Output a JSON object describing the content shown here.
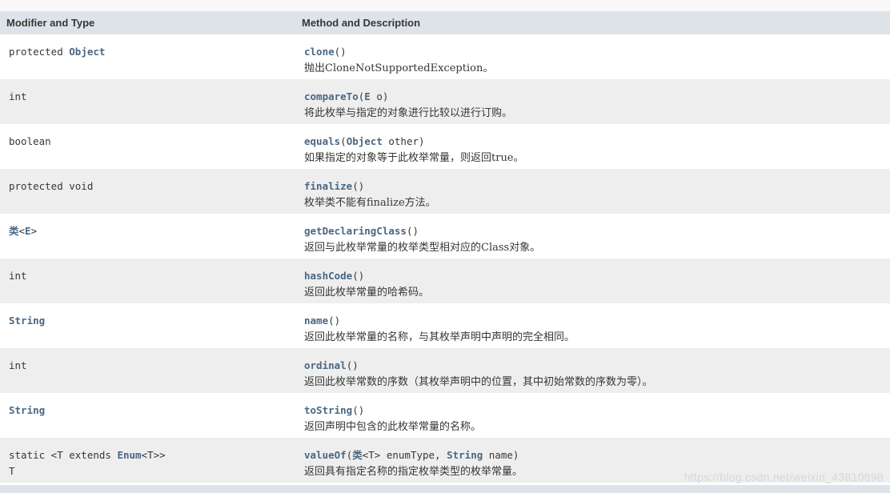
{
  "header": {
    "col1": "Modifier and Type",
    "col2": "Method and Description"
  },
  "rows": [
    {
      "type_parts": [
        {
          "t": "protected ",
          "link": false
        },
        {
          "t": "Object",
          "link": true
        }
      ],
      "method": "clone",
      "params": [
        {
          "t": "()",
          "link": false
        }
      ],
      "desc": "抛出CloneNotSupportedException。"
    },
    {
      "type_parts": [
        {
          "t": "int",
          "link": false
        }
      ],
      "method": "compareTo",
      "params": [
        {
          "t": "(",
          "link": false
        },
        {
          "t": "E",
          "link": true
        },
        {
          "t": " o)",
          "link": false
        }
      ],
      "desc": "将此枚举与指定的对象进行比较以进行订购。"
    },
    {
      "type_parts": [
        {
          "t": "boolean",
          "link": false
        }
      ],
      "method": "equals",
      "params": [
        {
          "t": "(",
          "link": false
        },
        {
          "t": "Object",
          "link": true
        },
        {
          "t": " other)",
          "link": false
        }
      ],
      "desc": "如果指定的对象等于此枚举常量，则返回true。"
    },
    {
      "type_parts": [
        {
          "t": "protected void",
          "link": false
        }
      ],
      "method": "finalize",
      "params": [
        {
          "t": "()",
          "link": false
        }
      ],
      "desc": "枚举类不能有finalize方法。"
    },
    {
      "type_parts": [
        {
          "t": "类",
          "link": true
        },
        {
          "t": "<",
          "link": false
        },
        {
          "t": "E",
          "link": true
        },
        {
          "t": ">",
          "link": false
        }
      ],
      "method": "getDeclaringClass",
      "params": [
        {
          "t": "()",
          "link": false
        }
      ],
      "desc": "返回与此枚举常量的枚举类型相对应的Class对象。"
    },
    {
      "type_parts": [
        {
          "t": "int",
          "link": false
        }
      ],
      "method": "hashCode",
      "params": [
        {
          "t": "()",
          "link": false
        }
      ],
      "desc": "返回此枚举常量的哈希码。"
    },
    {
      "type_parts": [
        {
          "t": "String",
          "link": true
        }
      ],
      "method": "name",
      "params": [
        {
          "t": "()",
          "link": false
        }
      ],
      "desc": "返回此枚举常量的名称，与其枚举声明中声明的完全相同。"
    },
    {
      "type_parts": [
        {
          "t": "int",
          "link": false
        }
      ],
      "method": "ordinal",
      "params": [
        {
          "t": "()",
          "link": false
        }
      ],
      "desc": "返回此枚举常数的序数（其枚举声明中的位置，其中初始常数的序数为零）。"
    },
    {
      "type_parts": [
        {
          "t": "String",
          "link": true
        }
      ],
      "method": "toString",
      "params": [
        {
          "t": "()",
          "link": false
        }
      ],
      "desc": "返回声明中包含的此枚举常量的名称。"
    },
    {
      "type_parts": [
        {
          "t": "static <T extends ",
          "link": false
        },
        {
          "t": "Enum",
          "link": true
        },
        {
          "t": "<T>>\nT",
          "link": false
        }
      ],
      "method": "valueOf",
      "params": [
        {
          "t": "(",
          "link": false
        },
        {
          "t": "类",
          "link": true
        },
        {
          "t": "<T> enumType, ",
          "link": false
        },
        {
          "t": "String",
          "link": true
        },
        {
          "t": " name)",
          "link": false
        }
      ],
      "desc": "返回具有指定名称的指定枚举类型的枚举常量。"
    }
  ],
  "watermark": "https://blog.csdn.net/weixin_43810898",
  "colors": {
    "header_bg": "#dee3e9",
    "row_alt_bg": "#eeeeef",
    "link": "#4a6782",
    "text": "#353833"
  }
}
